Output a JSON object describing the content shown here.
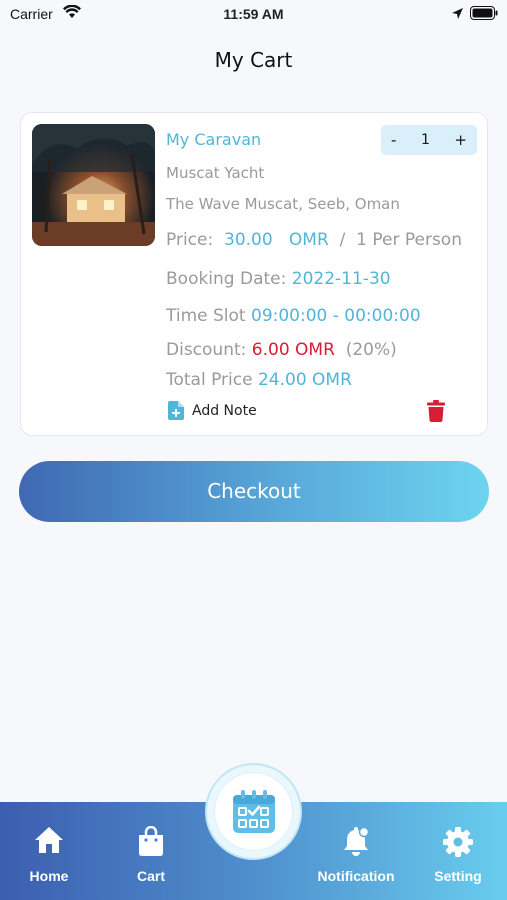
{
  "status_bar": {
    "carrier": "Carrier",
    "time": "11:59 AM"
  },
  "header": {
    "title": "My Cart"
  },
  "cart_item": {
    "name": "My Caravan",
    "quantity": {
      "minus": "-",
      "value": "1",
      "plus": "+"
    },
    "subtitle": "Muscat Yacht",
    "location": "The Wave Muscat, Seeb, Oman",
    "price": {
      "label": "Price:",
      "amount": "30.00",
      "currency": "OMR",
      "separator": "/",
      "unit": "1 Per Person"
    },
    "booking_date": {
      "label": "Booking Date:",
      "value": "2022-11-30"
    },
    "time_slot": {
      "label": "Time Slot",
      "value": "09:00:00 - 00:00:00"
    },
    "discount": {
      "label": "Discount:",
      "value": "6.00 OMR",
      "percent": "(20%)"
    },
    "total_price": {
      "label": "Total Price",
      "value": "24.00 OMR"
    },
    "add_note_label": "Add Note"
  },
  "checkout_label": "Checkout",
  "bottom_nav": {
    "items": [
      {
        "label": "Home",
        "icon": "home-icon"
      },
      {
        "label": "Cart",
        "icon": "bag-icon"
      },
      {
        "label": "Notification",
        "icon": "bell-icon"
      },
      {
        "label": "Setting",
        "icon": "gear-icon"
      }
    ],
    "center_button_icon": "calendar-check-icon"
  },
  "colors": {
    "accent": "#4fb6d9",
    "discount": "#d81d35",
    "nav_gradient_start": "#3c5eaf",
    "nav_gradient_end": "#69cdee"
  }
}
